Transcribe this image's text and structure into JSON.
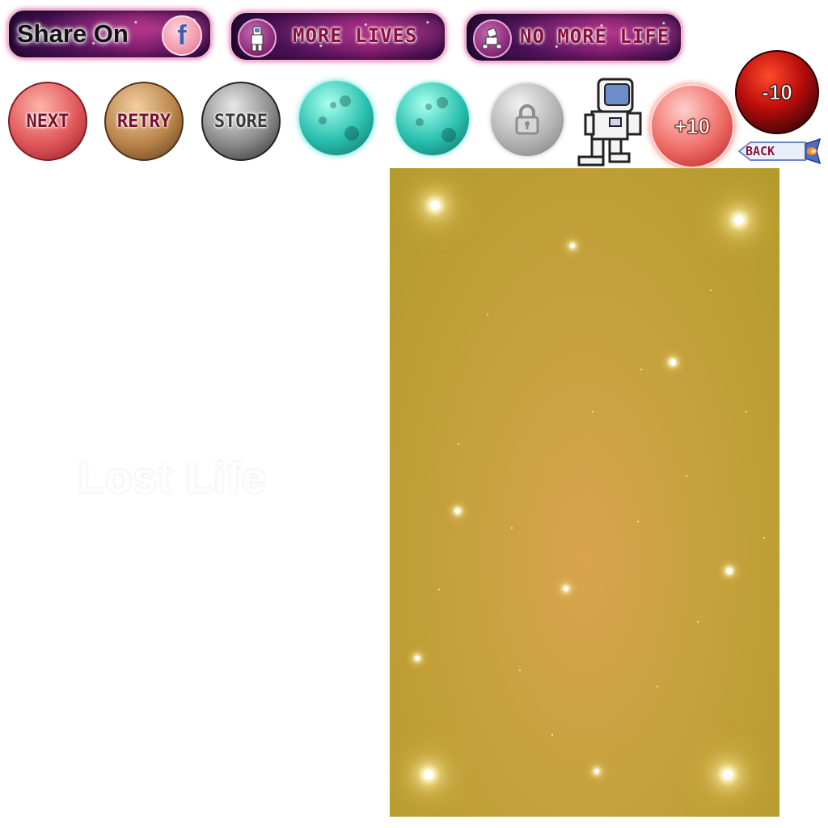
{
  "share_banner": {
    "label": "Share On",
    "fb_glyph": "f"
  },
  "more_lives_banner": {
    "label": "MORE LIVES",
    "icon": "astronaut-icon"
  },
  "no_more_life_banner": {
    "label": "NO MORE LIFE",
    "icon": "fallen-astronaut-icon"
  },
  "buttons": {
    "next": "NEXT",
    "retry": "RETRY",
    "store": "STORE",
    "plus_ten": "+10",
    "minus_ten": "-10",
    "back": "BACK"
  },
  "lost_life_text": "Lost Life",
  "colors": {
    "next_orb": "#e0565a",
    "retry_orb": "#b9844a",
    "store_orb": "#8a8a8a",
    "teal_planet": "#29bfae",
    "locked_planet": "#b4b4b4",
    "plus_orb": "#ef6a64",
    "minus_orb": "#b80c0c",
    "background_panel": "#c8a23e",
    "banner_purple": "#5a1460",
    "label_text": "#8a0f3c"
  }
}
